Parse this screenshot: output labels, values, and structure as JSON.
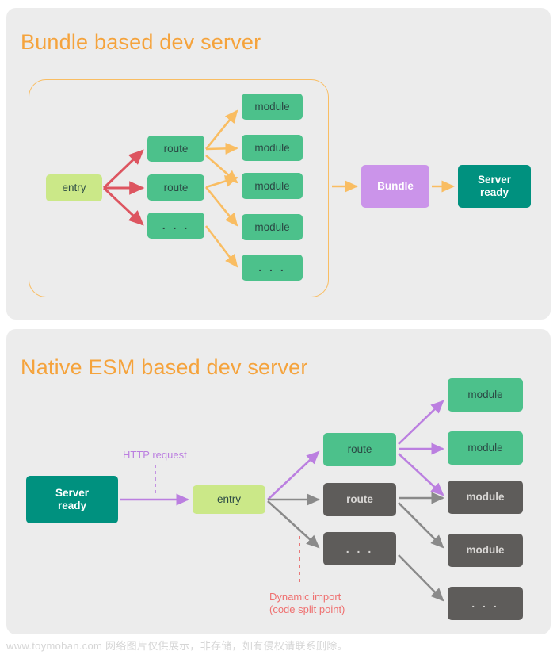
{
  "panels": [
    {
      "id": "bundle",
      "title": "Bundle based dev server",
      "nodes": {
        "entry": "entry",
        "route1": "route",
        "route2": "route",
        "route_ellipsis": ". . .",
        "module1": "module",
        "module2": "module",
        "module3": "module",
        "module4": "module",
        "module_ellipsis": ". . .",
        "bundle": "Bundle",
        "server_ready": "Server\nready"
      }
    },
    {
      "id": "esm",
      "title": "Native ESM based dev server",
      "nodes": {
        "server_ready": "Server\nready",
        "entry": "entry",
        "route1": "route",
        "route2": "route",
        "route_ellipsis": ". . .",
        "module1": "module",
        "module2": "module",
        "module3": "module",
        "module4": "module",
        "module_ellipsis": ". . ."
      },
      "annotations": {
        "http_request": "HTTP request",
        "dynamic_import_line1": "Dynamic import",
        "dynamic_import_line2": "(code split point)"
      }
    }
  ],
  "watermark": "www.toymoban.com 网络图片仅供展示，非存储，如有侵权请联系删除。",
  "colors": {
    "panel_bg": "#ececec",
    "title_orange": "#f5a33c",
    "group_border": "#f9bd62",
    "green": "#4cc18b",
    "lime": "#cbe888",
    "purple": "#cb94ea",
    "teal": "#00917f",
    "gray": "#5e5c5a",
    "arrow_orange": "#f9bd62",
    "arrow_red": "#dd5560",
    "arrow_purple": "#bb7fe0",
    "arrow_gray": "#8a8a8a",
    "annotation_red": "#ef7070",
    "watermark": "#d6d6d6"
  }
}
